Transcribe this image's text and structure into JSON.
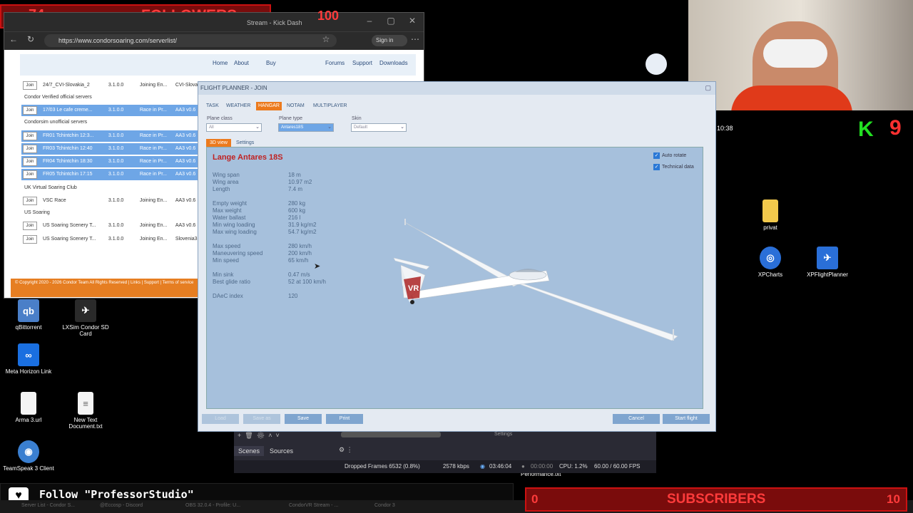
{
  "overlay": {
    "followers_count": "74",
    "followers_label": "FOLLOWERS",
    "followers_goal": "100",
    "subscribers_count": "0",
    "subscribers_label": "SUBSCRIBERS",
    "subscribers_goal": "10",
    "follow_text": "Follow \"ProfessorStudio\"",
    "kick_count": "9",
    "clock": "10:38"
  },
  "browser": {
    "tab_title": "Stream - Kick Dash",
    "url": "https://www.condorsoaring.com/serverlist/",
    "sign_in": "Sign in",
    "nav": [
      "Home",
      "About",
      "Buy",
      "Forums",
      "Support",
      "Downloads"
    ],
    "groups": [
      {
        "label": "Condor Verified official servers"
      },
      {
        "label": "Condorsim unofficial servers"
      },
      {
        "label": "UK Virtual Soaring Club"
      },
      {
        "label": "US Soaring"
      }
    ],
    "rows": [
      {
        "name": "24/7_CVI-Slovakia_2",
        "ver": "3.1.0.0",
        "status": "Joining En...",
        "scen": "CVI-Slova..."
      },
      {
        "name": "17/03 Le cafe creme...",
        "ver": "3.1.0.0",
        "status": "Race in Pr...",
        "scen": "AA3 v0.6"
      },
      {
        "name": "FR01 Tchintchin 12:3...",
        "ver": "3.1.0.0",
        "status": "Race in Pr...",
        "scen": "AA3 v0.6"
      },
      {
        "name": "FR03 Tchintchin 12:40",
        "ver": "3.1.0.0",
        "status": "Race in Pr...",
        "scen": "AA3 v0.6"
      },
      {
        "name": "FR04 Tchintchin 18:30",
        "ver": "3.1.0.0",
        "status": "Race in Pr...",
        "scen": "AA3 v0.6"
      },
      {
        "name": "FR05 Tchintchin 17:15",
        "ver": "3.1.0.0",
        "status": "Race in Pr...",
        "scen": "AA3 v0.6"
      },
      {
        "name": "VSC Race",
        "ver": "3.1.0.0",
        "status": "Joining En...",
        "scen": "AA3 v0.6"
      },
      {
        "name": "US Soaring Scenery T...",
        "ver": "3.1.0.0",
        "status": "Joining En...",
        "scen": "AA3 v0.6"
      },
      {
        "name": "US Soaring Scenery T...",
        "ver": "3.1.0.0",
        "status": "Joining En...",
        "scen": "Slovenia3"
      }
    ],
    "join_label": "Join",
    "footer": "© Copyright 2020 - 2026 Condor Team  All Rights Reserved | Links | Support | Terms of service"
  },
  "desktop_icons": [
    {
      "label": "qBittorrent",
      "icon": "qbittorrent-icon",
      "glyph": "qb",
      "color": "#4a7fc8"
    },
    {
      "label": "LXSim Condor SD Card",
      "icon": "lxsim-icon",
      "glyph": "✈",
      "color": "#2a2a2a"
    },
    {
      "label": "Meta Horizon Link",
      "icon": "meta-icon",
      "glyph": "∞",
      "color": "#1a6fe0"
    },
    {
      "label": "Arma 3.url",
      "icon": "file-icon",
      "glyph": "",
      "color": "#f4f4f4"
    },
    {
      "label": "New Text Document.txt",
      "icon": "text-file-icon",
      "glyph": "≡",
      "color": "#f4f4f4"
    },
    {
      "label": "TeamSpeak 3 Client",
      "icon": "teamspeak-icon",
      "glyph": "◉",
      "color": "#3a7fd0"
    },
    {
      "label": "privat",
      "icon": "folder-icon",
      "glyph": "",
      "color": "#f2c94c"
    },
    {
      "label": "XPCharts",
      "icon": "xpcharts-icon",
      "glyph": "◎",
      "color": "#2a6fd8"
    },
    {
      "label": "XPFlightPlanner",
      "icon": "xpflightplanner-icon",
      "glyph": "✈",
      "color": "#2a6fd8"
    }
  ],
  "planner": {
    "title": "FLIGHT PLANNER - JOIN",
    "tabs": [
      "TASK",
      "WEATHER",
      "HANGAR",
      "NOTAM",
      "MULTIPLAYER"
    ],
    "plane_class_label": "Plane class",
    "plane_class_value": "All",
    "plane_type_label": "Plane type",
    "plane_type_value": "Antares18S",
    "skin_label": "Skin",
    "skin_value": "Default",
    "subtabs": [
      "3D view",
      "Settings"
    ],
    "glider_name": "Lange Antares 18S",
    "tail_mark": "VR",
    "auto_rotate": "Auto rotate",
    "technical_data": "Technical data",
    "specs": [
      {
        "label": "Wing span",
        "value": "18 m"
      },
      {
        "label": "Wing area",
        "value": "10.97 m2"
      },
      {
        "label": "Length",
        "value": "7.4 m"
      },
      {
        "label": "Empty weight",
        "value": "280 kg"
      },
      {
        "label": "Max weight",
        "value": "600 kg"
      },
      {
        "label": "Water ballast",
        "value": "216 l"
      },
      {
        "label": "Min wing loading",
        "value": "31.9 kg/m2"
      },
      {
        "label": "Max wing loading",
        "value": "54.7 kg/m2"
      },
      {
        "label": "Max speed",
        "value": "280 km/h"
      },
      {
        "label": "Maneuvering speed",
        "value": "200 km/h"
      },
      {
        "label": "Min speed",
        "value": "65 km/h"
      },
      {
        "label": "Min sink",
        "value": "0.47 m/s"
      },
      {
        "label": "Best glide ratio",
        "value": "52 at 100 km/h"
      },
      {
        "label": "DAeC index",
        "value": "120"
      }
    ],
    "buttons": {
      "load": "Load",
      "save_as": "Save as",
      "save": "Save",
      "print": "Print",
      "cancel": "Cancel",
      "start_flight": "Start flight"
    }
  },
  "obs": {
    "scenes": "Scenes",
    "sources": "Sources",
    "settings": "Settings",
    "dropped": "Dropped Frames 6532 (0.8%)",
    "bitrate": "2578 kbps",
    "live_time": "03:46:04",
    "rec_time": "00:00:00",
    "cpu": "CPU: 1.2%",
    "fps": "60.00 / 60.00 FPS",
    "performance": "Performance.txt"
  },
  "taskbar": {
    "items": [
      "Server List - Condor S...",
      "@Eccosp - Discord",
      "OBS 32.0.4 - Profile: U...",
      "CondorVR Stream - ...",
      "Condor 3"
    ]
  }
}
